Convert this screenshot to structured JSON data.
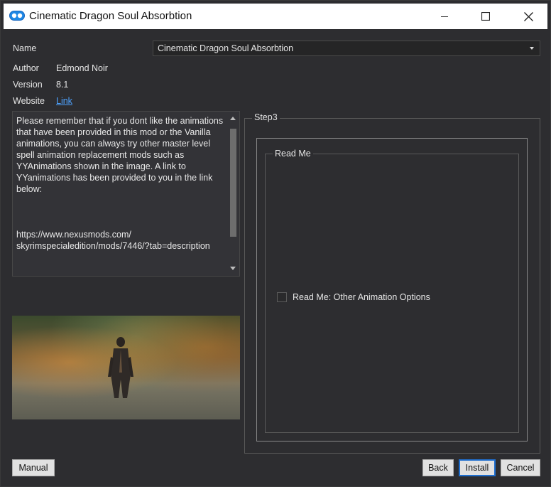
{
  "window": {
    "title": "Cinematic Dragon Soul Absorbtion",
    "icon": "app-logo-icon",
    "controls": [
      "minimize-icon",
      "maximize-icon",
      "close-icon"
    ]
  },
  "info": {
    "name_label": "Name",
    "name_value": "Cinematic Dragon Soul Absorbtion",
    "author_label": "Author",
    "author_value": "Edmond Noir",
    "version_label": "Version",
    "version_value": "8.1",
    "website_label": "Website",
    "website_link": "Link"
  },
  "description": "Please remember that if you dont like the animations that have been provided in this mod or the Vanilla animations, you can always try other master level spell animation replacement mods such as YYAnimations shown in the image. A link to YYanimations has been provided to you in the link below:\n\n\n\nhttps://www.nexusmods.com/\nskyrimspecialedition/mods/7446/?tab=description",
  "step": {
    "title": "Step3",
    "group_title": "Read Me",
    "option_label": "Read Me: Other Animation Options",
    "option_checked": false
  },
  "buttons": {
    "manual": "Manual",
    "back": "Back",
    "install": "Install",
    "cancel": "Cancel"
  },
  "colors": {
    "background": "#2d2d30",
    "link": "#4ea3ff",
    "accent": "#1f6fd0"
  }
}
